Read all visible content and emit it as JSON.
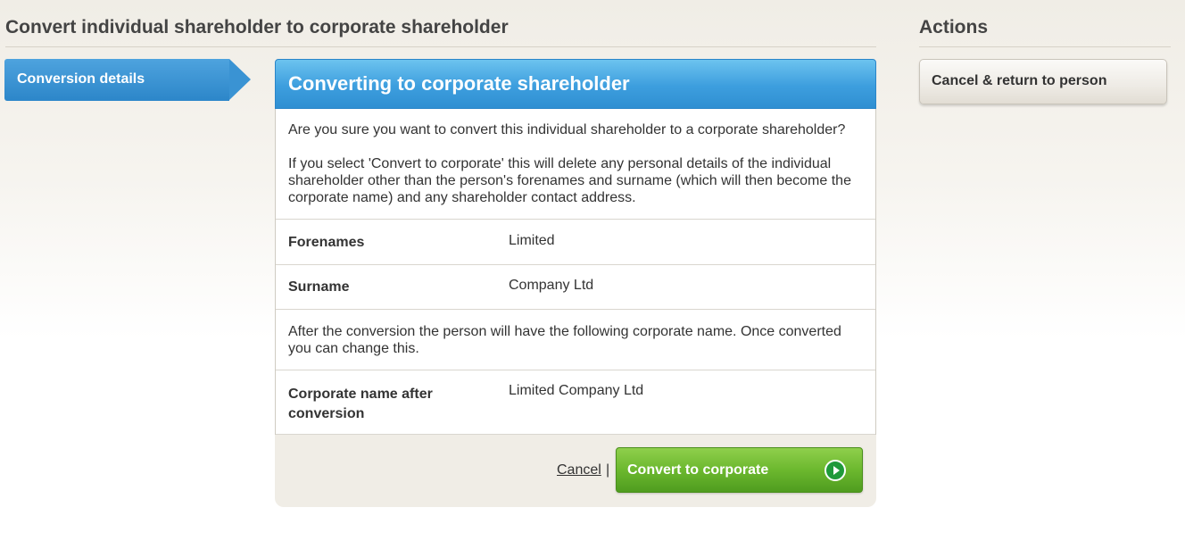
{
  "header": {
    "title": "Convert individual shareholder to corporate shareholder"
  },
  "steps": {
    "current_label": "Conversion details"
  },
  "panel": {
    "title": "Converting to corporate shareholder",
    "question": "Are you sure you want to convert this individual shareholder to a corporate shareholder?",
    "warning": "If you select 'Convert to corporate' this will delete any personal details of the individual shareholder other than the person's forenames and surname (which will then become the corporate name) and any shareholder contact address.",
    "fields": {
      "forenames_label": "Forenames",
      "forenames_value": "Limited",
      "surname_label": "Surname",
      "surname_value": "Company Ltd"
    },
    "note": "After the conversion the person will have the following corporate name. Once converted you can change this.",
    "corporate": {
      "label": "Corporate name after conversion",
      "value": "Limited Company Ltd"
    },
    "footer": {
      "cancel_label": "Cancel",
      "separator": "|",
      "convert_label": "Convert to corporate"
    }
  },
  "actions": {
    "title": "Actions",
    "cancel_return_label": "Cancel & return to person"
  },
  "colors": {
    "accent_blue": "#3d9ede",
    "convert_green": "#6cb82e"
  }
}
